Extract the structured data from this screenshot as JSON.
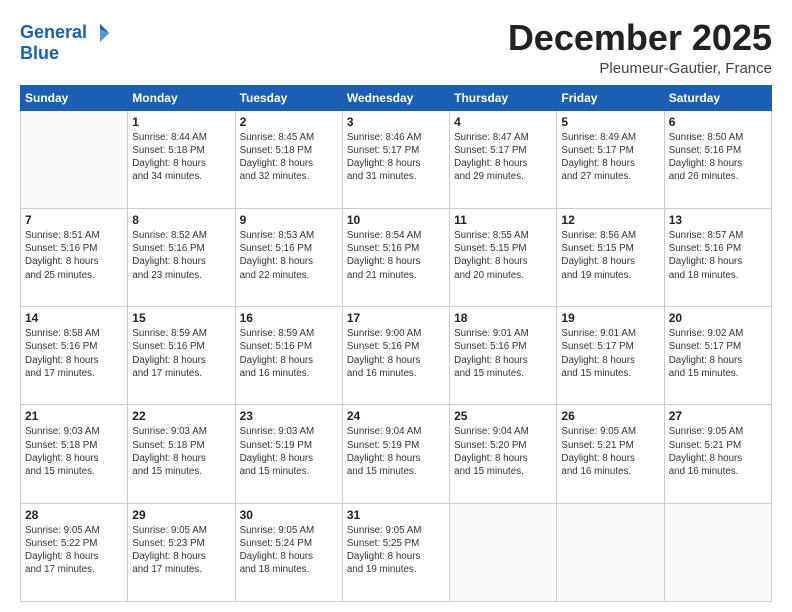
{
  "logo": {
    "line1": "General",
    "line2": "Blue"
  },
  "header": {
    "month": "December 2025",
    "location": "Pleumeur-Gautier, France"
  },
  "weekdays": [
    "Sunday",
    "Monday",
    "Tuesday",
    "Wednesday",
    "Thursday",
    "Friday",
    "Saturday"
  ],
  "weeks": [
    [
      {
        "day": "",
        "info": ""
      },
      {
        "day": "1",
        "info": "Sunrise: 8:44 AM\nSunset: 5:18 PM\nDaylight: 8 hours\nand 34 minutes."
      },
      {
        "day": "2",
        "info": "Sunrise: 8:45 AM\nSunset: 5:18 PM\nDaylight: 8 hours\nand 32 minutes."
      },
      {
        "day": "3",
        "info": "Sunrise: 8:46 AM\nSunset: 5:17 PM\nDaylight: 8 hours\nand 31 minutes."
      },
      {
        "day": "4",
        "info": "Sunrise: 8:47 AM\nSunset: 5:17 PM\nDaylight: 8 hours\nand 29 minutes."
      },
      {
        "day": "5",
        "info": "Sunrise: 8:49 AM\nSunset: 5:17 PM\nDaylight: 8 hours\nand 27 minutes."
      },
      {
        "day": "6",
        "info": "Sunrise: 8:50 AM\nSunset: 5:16 PM\nDaylight: 8 hours\nand 26 minutes."
      }
    ],
    [
      {
        "day": "7",
        "info": "Sunrise: 8:51 AM\nSunset: 5:16 PM\nDaylight: 8 hours\nand 25 minutes."
      },
      {
        "day": "8",
        "info": "Sunrise: 8:52 AM\nSunset: 5:16 PM\nDaylight: 8 hours\nand 23 minutes."
      },
      {
        "day": "9",
        "info": "Sunrise: 8:53 AM\nSunset: 5:16 PM\nDaylight: 8 hours\nand 22 minutes."
      },
      {
        "day": "10",
        "info": "Sunrise: 8:54 AM\nSunset: 5:16 PM\nDaylight: 8 hours\nand 21 minutes."
      },
      {
        "day": "11",
        "info": "Sunrise: 8:55 AM\nSunset: 5:15 PM\nDaylight: 8 hours\nand 20 minutes."
      },
      {
        "day": "12",
        "info": "Sunrise: 8:56 AM\nSunset: 5:15 PM\nDaylight: 8 hours\nand 19 minutes."
      },
      {
        "day": "13",
        "info": "Sunrise: 8:57 AM\nSunset: 5:16 PM\nDaylight: 8 hours\nand 18 minutes."
      }
    ],
    [
      {
        "day": "14",
        "info": "Sunrise: 8:58 AM\nSunset: 5:16 PM\nDaylight: 8 hours\nand 17 minutes."
      },
      {
        "day": "15",
        "info": "Sunrise: 8:59 AM\nSunset: 5:16 PM\nDaylight: 8 hours\nand 17 minutes."
      },
      {
        "day": "16",
        "info": "Sunrise: 8:59 AM\nSunset: 5:16 PM\nDaylight: 8 hours\nand 16 minutes."
      },
      {
        "day": "17",
        "info": "Sunrise: 9:00 AM\nSunset: 5:16 PM\nDaylight: 8 hours\nand 16 minutes."
      },
      {
        "day": "18",
        "info": "Sunrise: 9:01 AM\nSunset: 5:16 PM\nDaylight: 8 hours\nand 15 minutes."
      },
      {
        "day": "19",
        "info": "Sunrise: 9:01 AM\nSunset: 5:17 PM\nDaylight: 8 hours\nand 15 minutes."
      },
      {
        "day": "20",
        "info": "Sunrise: 9:02 AM\nSunset: 5:17 PM\nDaylight: 8 hours\nand 15 minutes."
      }
    ],
    [
      {
        "day": "21",
        "info": "Sunrise: 9:03 AM\nSunset: 5:18 PM\nDaylight: 8 hours\nand 15 minutes."
      },
      {
        "day": "22",
        "info": "Sunrise: 9:03 AM\nSunset: 5:18 PM\nDaylight: 8 hours\nand 15 minutes."
      },
      {
        "day": "23",
        "info": "Sunrise: 9:03 AM\nSunset: 5:19 PM\nDaylight: 8 hours\nand 15 minutes."
      },
      {
        "day": "24",
        "info": "Sunrise: 9:04 AM\nSunset: 5:19 PM\nDaylight: 8 hours\nand 15 minutes."
      },
      {
        "day": "25",
        "info": "Sunrise: 9:04 AM\nSunset: 5:20 PM\nDaylight: 8 hours\nand 15 minutes."
      },
      {
        "day": "26",
        "info": "Sunrise: 9:05 AM\nSunset: 5:21 PM\nDaylight: 8 hours\nand 16 minutes."
      },
      {
        "day": "27",
        "info": "Sunrise: 9:05 AM\nSunset: 5:21 PM\nDaylight: 8 hours\nand 16 minutes."
      }
    ],
    [
      {
        "day": "28",
        "info": "Sunrise: 9:05 AM\nSunset: 5:22 PM\nDaylight: 8 hours\nand 17 minutes."
      },
      {
        "day": "29",
        "info": "Sunrise: 9:05 AM\nSunset: 5:23 PM\nDaylight: 8 hours\nand 17 minutes."
      },
      {
        "day": "30",
        "info": "Sunrise: 9:05 AM\nSunset: 5:24 PM\nDaylight: 8 hours\nand 18 minutes."
      },
      {
        "day": "31",
        "info": "Sunrise: 9:05 AM\nSunset: 5:25 PM\nDaylight: 8 hours\nand 19 minutes."
      },
      {
        "day": "",
        "info": ""
      },
      {
        "day": "",
        "info": ""
      },
      {
        "day": "",
        "info": ""
      }
    ]
  ]
}
